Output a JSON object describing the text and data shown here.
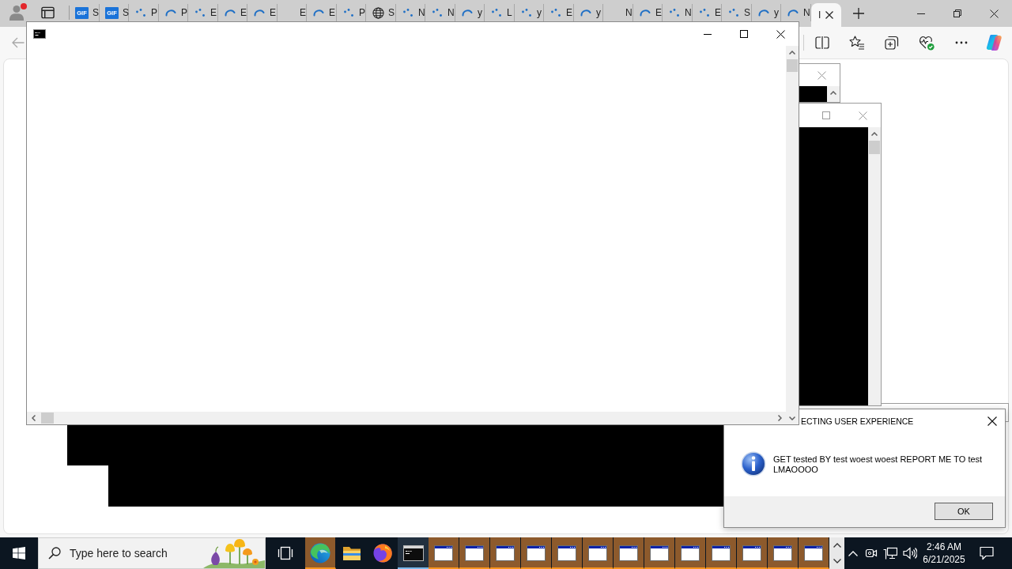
{
  "browser": {
    "tabs": [
      {
        "kind": "gif",
        "favicon_label": "GIF",
        "label": "S",
        "selected": false
      },
      {
        "kind": "gif",
        "favicon_label": "GIF",
        "label": "S",
        "selected": false
      },
      {
        "kind": "dots",
        "label": "P",
        "selected": false
      },
      {
        "kind": "arc",
        "label": "P",
        "selected": false
      },
      {
        "kind": "dots",
        "label": "E",
        "selected": false
      },
      {
        "kind": "arc",
        "label": "E",
        "selected": false
      },
      {
        "kind": "arc",
        "label": "E",
        "selected": false
      },
      {
        "kind": "plain",
        "label": "E",
        "selected": false
      },
      {
        "kind": "arc",
        "label": "E",
        "selected": false
      },
      {
        "kind": "dots",
        "label": "P",
        "selected": false
      },
      {
        "kind": "globe",
        "label": "S",
        "selected": false
      },
      {
        "kind": "dots",
        "label": "N",
        "selected": false
      },
      {
        "kind": "dots",
        "label": "N",
        "selected": false
      },
      {
        "kind": "arc",
        "label": "y",
        "selected": false
      },
      {
        "kind": "dots",
        "label": "L",
        "selected": false
      },
      {
        "kind": "dots",
        "label": "y",
        "selected": false
      },
      {
        "kind": "dots",
        "label": "E",
        "selected": false
      },
      {
        "kind": "arc",
        "label": "y",
        "selected": false
      },
      {
        "kind": "plain",
        "label": "N",
        "selected": false
      },
      {
        "kind": "arc",
        "label": "E",
        "selected": false
      },
      {
        "kind": "dots",
        "label": "N",
        "selected": false
      },
      {
        "kind": "dots",
        "label": "E",
        "selected": false
      },
      {
        "kind": "dots",
        "label": "S",
        "selected": false
      },
      {
        "kind": "arc",
        "label": "y",
        "selected": false
      },
      {
        "kind": "arc",
        "label": "N",
        "selected": false
      },
      {
        "kind": "plain",
        "label": "I",
        "selected": true
      }
    ]
  },
  "message_box": {
    "title": "ECTING USER EXPERIENCE",
    "message": "GET tested BY test woest woest REPORT ME TO test LMAOOOO",
    "buttons": [
      "OK"
    ]
  },
  "taskbar": {
    "search": {
      "placeholder": "Type here to search"
    },
    "apps": [
      {
        "kind": "edge",
        "flashing": true,
        "active": false
      },
      {
        "kind": "explorer",
        "flashing": false,
        "active": false
      },
      {
        "kind": "firefox",
        "flashing": false,
        "active": false
      },
      {
        "kind": "cmd",
        "flashing": false,
        "active": true
      },
      {
        "kind": "window",
        "flashing": true,
        "active": false
      },
      {
        "kind": "window",
        "flashing": true,
        "active": false
      },
      {
        "kind": "window",
        "flashing": true,
        "active": false
      },
      {
        "kind": "window",
        "flashing": true,
        "active": false
      },
      {
        "kind": "window",
        "flashing": true,
        "active": false
      },
      {
        "kind": "window",
        "flashing": true,
        "active": false
      },
      {
        "kind": "window",
        "flashing": true,
        "active": false
      },
      {
        "kind": "window",
        "flashing": true,
        "active": false
      },
      {
        "kind": "window",
        "flashing": true,
        "active": false
      },
      {
        "kind": "window",
        "flashing": true,
        "active": false
      },
      {
        "kind": "window",
        "flashing": true,
        "active": false
      },
      {
        "kind": "window",
        "flashing": true,
        "active": false
      },
      {
        "kind": "window",
        "flashing": true,
        "active": false
      }
    ],
    "clock": {
      "time": "2:46 AM",
      "date": "6/21/2025"
    }
  }
}
